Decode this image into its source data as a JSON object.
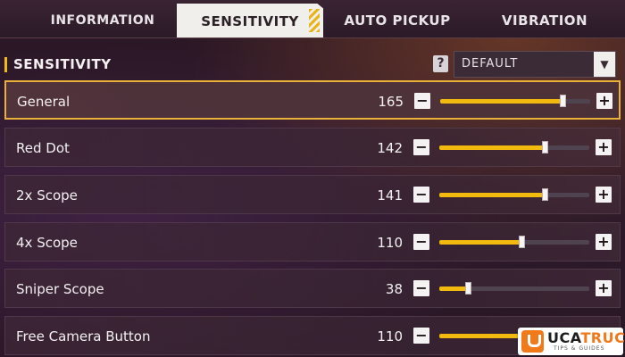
{
  "tabs": [
    {
      "label": "INFORMATION",
      "active": false
    },
    {
      "label": "SENSITIVITY",
      "active": true
    },
    {
      "label": "AUTO PICKUP",
      "active": false
    },
    {
      "label": "VIBRATION",
      "active": false
    }
  ],
  "section": {
    "title": "SENSITIVITY",
    "help_icon_text": "?",
    "preset": "DEFAULT"
  },
  "rows": [
    {
      "label": "General",
      "value": "165",
      "fraction": 0.815
    },
    {
      "label": "Red Dot",
      "value": "142",
      "fraction": 0.7
    },
    {
      "label": "2x Scope",
      "value": "141",
      "fraction": 0.7
    },
    {
      "label": "4x Scope",
      "value": "110",
      "fraction": 0.545
    },
    {
      "label": "Sniper Scope",
      "value": "38",
      "fraction": 0.19
    },
    {
      "label": "Free Camera Button",
      "value": "110",
      "fraction": 0.545
    }
  ],
  "controls": {
    "minus_symbol": "−",
    "plus_symbol": "+"
  },
  "colors": {
    "accent": "#f2b90f",
    "selected_border": "#e9b13a",
    "active_tab_bg": "#f1efec"
  },
  "watermark": {
    "brand_prefix": "UCA",
    "brand_suffix": "TRUCO",
    "tagline": "TIPS & GUIDES"
  }
}
